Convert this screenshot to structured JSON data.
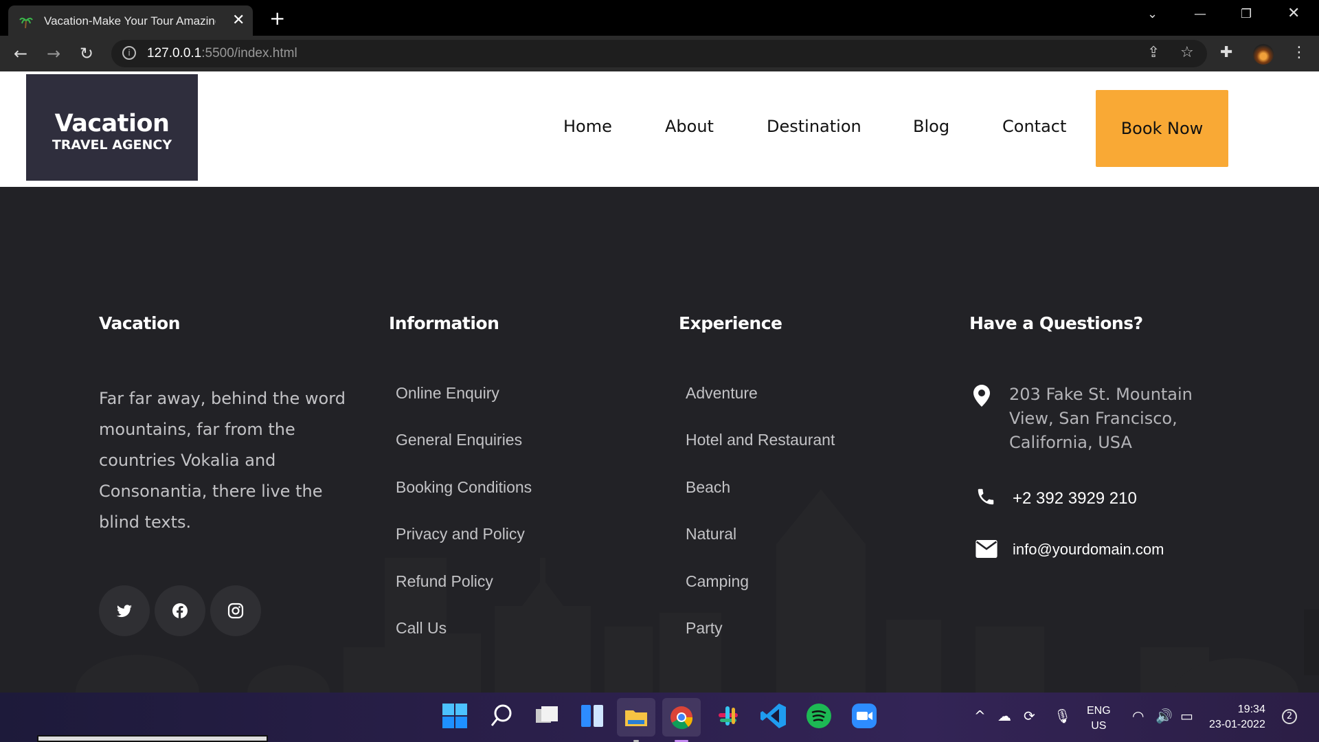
{
  "browser": {
    "tab_title": "Vacation-Make Your Tour Amazing",
    "url_host": "127.0.0.1",
    "url_path": ":5500/index.html"
  },
  "header": {
    "logo_name": "Vacation",
    "logo_sub": "TRAVEL AGENCY",
    "nav": [
      "Home",
      "About",
      "Destination",
      "Blog",
      "Contact"
    ],
    "book_now": "Book Now",
    "accent": "#f9a935"
  },
  "footer": {
    "col1": {
      "title": "Vacation",
      "text": "Far far away, behind the word mountains, far from the countries Vokalia and Consonantia, there live the blind texts."
    },
    "col2": {
      "title": "Information",
      "links": [
        "Online Enquiry",
        "General Enquiries",
        "Booking Conditions",
        "Privacy and Policy",
        "Refund Policy",
        "Call Us"
      ]
    },
    "col3": {
      "title": "Experience",
      "links": [
        "Adventure",
        "Hotel and Restaurant",
        "Beach",
        "Natural",
        "Camping",
        "Party"
      ]
    },
    "col4": {
      "title": "Have a Questions?",
      "address": "203 Fake St. Mountain View, San Francisco, California, USA",
      "phone": "+2 392 3929 210",
      "email": "info@yourdomain.com"
    },
    "social": [
      "twitter-icon",
      "facebook-icon",
      "instagram-icon"
    ],
    "background": "#222226"
  },
  "taskbar": {
    "lang_line1": "ENG",
    "lang_line2": "US",
    "time": "19:34",
    "date": "23-01-2022",
    "notifications": "2"
  }
}
